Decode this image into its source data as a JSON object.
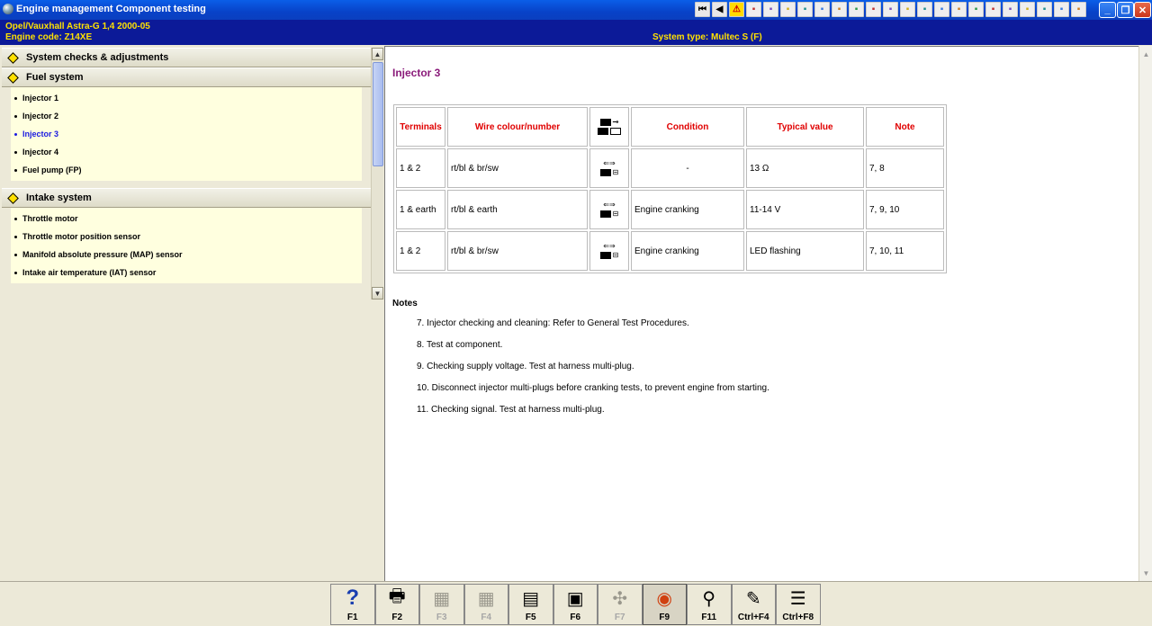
{
  "window": {
    "title": "Engine management Component testing",
    "minimize": "_",
    "maximize": "❐",
    "close": "✕"
  },
  "toolbar": {
    "icons": [
      "first-icon",
      "back-icon",
      "warning-icon",
      "tool-1-icon",
      "tool-2-icon",
      "tool-3-icon",
      "tool-4-icon",
      "tool-5-icon",
      "tool-6-icon",
      "tool-7-icon",
      "tool-8-icon",
      "tool-9-icon",
      "tool-10-icon",
      "tool-11-icon",
      "tool-12-icon",
      "tool-13-icon",
      "tool-14-icon",
      "tool-15-icon",
      "tool-16-icon",
      "tool-17-icon",
      "tool-18-icon",
      "tool-19-icon",
      "tool-20-icon"
    ]
  },
  "info": {
    "vehicle": "Opel/Vauxhall   Astra-G  1,4  2000-05",
    "engine": "Engine code: Z14XE",
    "system_type": "System type: Multec S (F)"
  },
  "sidebar": {
    "sections": [
      {
        "label": "System checks & adjustments",
        "items": []
      },
      {
        "label": "Fuel system",
        "items": [
          "Injector 1",
          "Injector 2",
          "Injector 3",
          "Injector 4",
          "Fuel pump (FP)"
        ]
      },
      {
        "label": "Intake system",
        "items": [
          "Throttle motor",
          "Throttle motor position sensor",
          "Manifold absolute pressure (MAP) sensor",
          "Intake air temperature (IAT) sensor"
        ]
      }
    ],
    "active_item": "Injector 3"
  },
  "content": {
    "heading": "Injector 3",
    "table": {
      "headers": [
        "Terminals",
        "Wire colour/number",
        "",
        "Condition",
        "Typical value",
        "Note"
      ],
      "rows": [
        {
          "terminals": "1 & 2",
          "wire": "rt/bl & br/sw",
          "condition": "-",
          "value": "13 Ω",
          "note": "7, 8"
        },
        {
          "terminals": "1 & earth",
          "wire": "rt/bl & earth",
          "condition": "Engine cranking",
          "value": "11-14 V",
          "note": "7, 9, 10"
        },
        {
          "terminals": "1 & 2",
          "wire": "rt/bl & br/sw",
          "condition": "Engine cranking",
          "value": "LED flashing",
          "note": "7, 10, 11"
        }
      ]
    },
    "notes_title": "Notes",
    "notes": [
      "7. Injector checking and cleaning: Refer to General Test Procedures.",
      "8. Test at component.",
      "9. Checking supply voltage. Test at harness multi-plug.",
      "10. Disconnect injector multi-plugs before cranking tests, to prevent engine from starting.",
      "11. Checking signal. Test at harness multi-plug."
    ]
  },
  "fkeys": [
    {
      "label": "F1",
      "icon": "help-icon",
      "glyph": "?",
      "enabled": true
    },
    {
      "label": "F2",
      "icon": "print-icon",
      "glyph": "🖶",
      "enabled": true
    },
    {
      "label": "F3",
      "icon": "diagram-icon",
      "glyph": "▦",
      "enabled": false
    },
    {
      "label": "F4",
      "icon": "diagram-2-icon",
      "glyph": "▦",
      "enabled": false
    },
    {
      "label": "F5",
      "icon": "component-icon",
      "glyph": "▤",
      "enabled": true
    },
    {
      "label": "F6",
      "icon": "connector-icon",
      "glyph": "▣",
      "enabled": true
    },
    {
      "label": "F7",
      "icon": "tool-icon",
      "glyph": "✣",
      "enabled": false
    },
    {
      "label": "F9",
      "icon": "location-icon",
      "glyph": "◉",
      "enabled": true,
      "pressed": true
    },
    {
      "label": "F11",
      "icon": "search-icon",
      "glyph": "⚲",
      "enabled": true
    },
    {
      "label": "Ctrl+F4",
      "icon": "notes-icon",
      "glyph": "✎",
      "enabled": true
    },
    {
      "label": "Ctrl+F8",
      "icon": "list-icon",
      "glyph": "☰",
      "enabled": true
    }
  ],
  "colors": {
    "title_bar": "#0842c8",
    "info_bar": "#0c1a98",
    "info_text": "#ffe100",
    "heading": "#8a1a7a",
    "table_header": "#e00000",
    "active_item": "#1a1ae0",
    "subitem_bg": "#ffffdf"
  }
}
